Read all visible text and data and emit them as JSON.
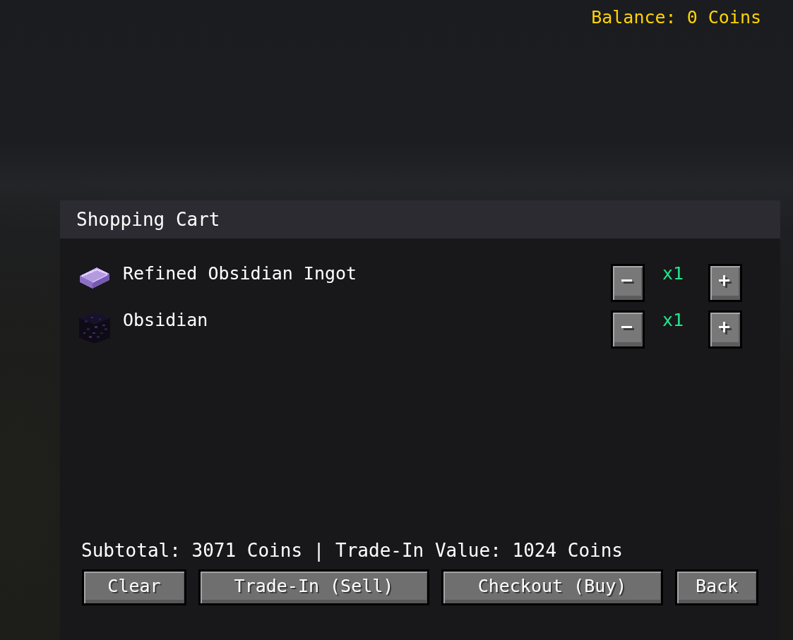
{
  "balance": "Balance: 0 Coins",
  "cart": {
    "title": "Shopping Cart",
    "items": [
      {
        "kind": "ingot",
        "name": "Refined Obsidian Ingot",
        "quantity": "x1"
      },
      {
        "kind": "block",
        "name": "Obsidian",
        "quantity": "x1"
      }
    ],
    "summary": "Subtotal: 3071 Coins | Trade-In Value: 1024 Coins",
    "buttons": [
      "Clear",
      "Trade-In (Sell)",
      "Checkout (Buy)",
      "Back"
    ]
  }
}
